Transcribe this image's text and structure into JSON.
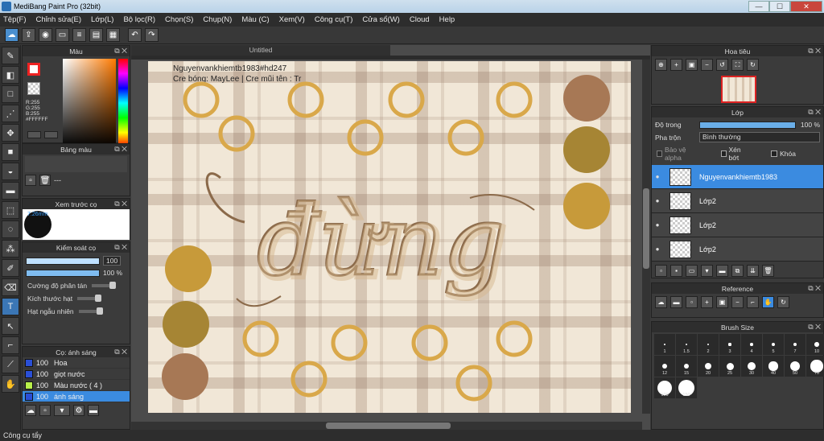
{
  "window": {
    "title": "MediBang Paint Pro (32bit)"
  },
  "menu": [
    "Tệp(F)",
    "Chỉnh sửa(E)",
    "Lớp(L)",
    "Bộ lọc(R)",
    "Chọn(S)",
    "Chụp(N)",
    "Màu (C)",
    "Xem(V)",
    "Công cụ(T)",
    "Cửa sổ(W)",
    "Cloud",
    "Help"
  ],
  "color_panel": {
    "title": "Màu",
    "r": "R:255",
    "g": "G:255",
    "b": "B:255",
    "hex": "#FFFFFF",
    "primary_color": "#ffffff"
  },
  "palette_panel": {
    "title": "Bảng màu",
    "none_text": "---"
  },
  "brush_preview": {
    "title": "Xem trước cọ",
    "size": "7.26mm"
  },
  "control_panel": {
    "title": "Kiểm soát cọ",
    "size_value": "100",
    "opacity_value": "100 %",
    "opt1": "Cường độ phân tán",
    "opt2": "Kích thước hạt",
    "opt3": "Hạt ngẫu nhiên"
  },
  "brush_panel": {
    "title": "Cọ: ánh sáng",
    "items": [
      {
        "size": "100",
        "name": "Hoa",
        "color": "#2a4fd6"
      },
      {
        "size": "100",
        "name": "giọt nước",
        "color": "#2a4fd6"
      },
      {
        "size": "100",
        "name": "Màu nước ( 4 )",
        "color": "#b9f04a"
      },
      {
        "size": "100",
        "name": "ánh sáng",
        "color": "#2a4fd6"
      }
    ]
  },
  "canvas": {
    "tab": "Untitled",
    "credit_line1": "Nguyenvankhiemtb1983#hd247",
    "credit_line2": "Cre bóng: MayLee  |  Cre mũi tên : Tr",
    "lettering": "đừng"
  },
  "navigator": {
    "title": "Hoa tiêu"
  },
  "layer_panel": {
    "title": "Lớp",
    "opacity_label": "Độ trong",
    "opacity_value": "100 %",
    "blend_label": "Pha trộn",
    "blend_value": "Bình thường",
    "protect_alpha": "Bảo vệ alpha",
    "clip": "Xén bớt",
    "lock": "Khóa",
    "layers": [
      {
        "name": "Nguyenvankhiemtb1983"
      },
      {
        "name": "Lớp2"
      },
      {
        "name": "Lớp2"
      },
      {
        "name": "Lớp2"
      }
    ]
  },
  "reference_panel": {
    "title": "Reference"
  },
  "brushsize_panel": {
    "title": "Brush Size",
    "sizes": [
      "1",
      "1.5",
      "2",
      "3",
      "4",
      "5",
      "7",
      "10",
      "12",
      "15",
      "20",
      "25",
      "30",
      "40",
      "50",
      "70",
      "100",
      "150"
    ]
  },
  "status": {
    "tool": "Công cụ tẩy"
  },
  "art_colors": {
    "gold": "#c79a3a",
    "olive": "#a68534",
    "tan": "#a77855",
    "ring": "#d9a84a"
  }
}
